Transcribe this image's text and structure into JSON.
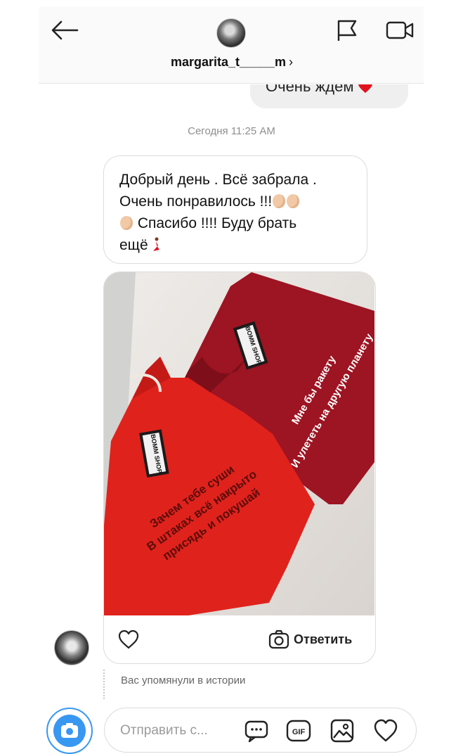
{
  "header": {
    "username": "margarita_t_____m",
    "chevron": "›",
    "icons": [
      "back-arrow-icon",
      "flag-icon",
      "video-call-icon"
    ]
  },
  "messages": {
    "outgoing_partial": "Очень ждем",
    "timestamp": "Сегодня 11:25 AM",
    "incoming_text_lines": [
      "Добрый день . Всё забрала .",
      "Очень понравилось !!!",
      "Спасибо !!!!  Буду брать",
      "ещё"
    ]
  },
  "story_card": {
    "shirt_back_lines": [
      "Мне бы ракету",
      "И улететь на другую планету"
    ],
    "shirt_front_lines": [
      "Зачем тебе суши",
      "В штаках всё накрыто",
      "присядь и покушай"
    ],
    "tag_text": "BOMM SHOP",
    "reply_label": "Ответить"
  },
  "mention": {
    "text": "Вас упомянули в истории"
  },
  "composer": {
    "placeholder": "Отправить с...",
    "gif_label": "GIF"
  },
  "colors": {
    "accent": "#3897f0",
    "bubble_gray": "#efefef",
    "shirt_red": "#e0201c",
    "shirt_maroon": "#a01322"
  }
}
